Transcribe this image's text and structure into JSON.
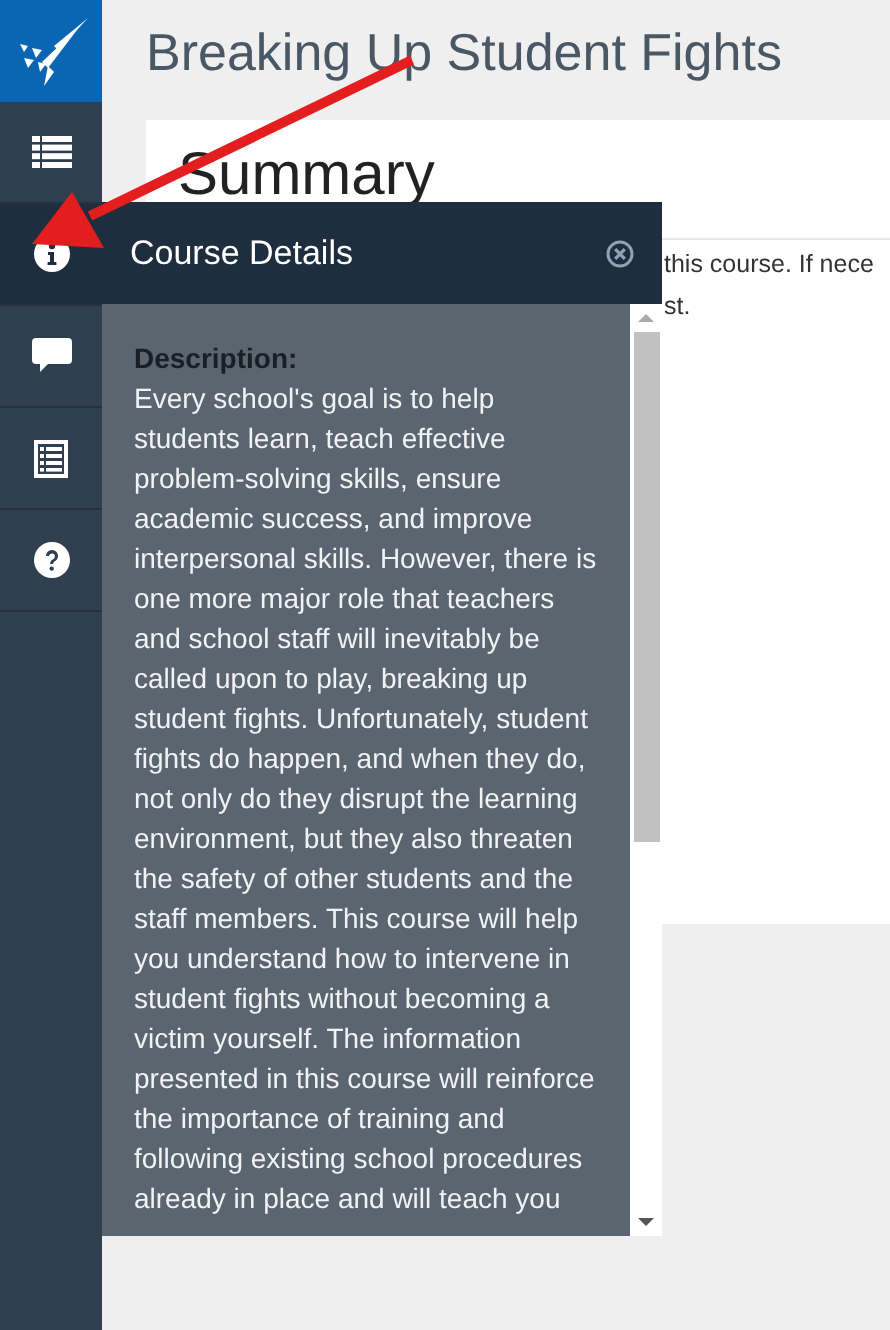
{
  "page_title": "Breaking Up Student Fights",
  "sidebar": {
    "items": [
      {
        "kind": "list",
        "selected": false
      },
      {
        "kind": "info",
        "selected": true
      },
      {
        "kind": "chat",
        "selected": false
      },
      {
        "kind": "table",
        "selected": false
      },
      {
        "kind": "help",
        "selected": false
      }
    ]
  },
  "card": {
    "heading": "Summary",
    "lines": [
      "this course. If nece",
      "st."
    ]
  },
  "panel": {
    "title": "Course Details",
    "description_label": "Description:",
    "description": "Every school's goal is to help students learn, teach effective problem-solving skills, ensure academic success, and improve interpersonal skills. However, there is one more major role that teachers and school staff will inevitably be called upon to play, breaking up student fights. Unfortunately, student fights do happen, and when they do, not only do they disrupt the learning environment, but they also threaten the safety of other students and the staff members. This course will help you understand how to intervene in student fights without becoming a victim yourself. The information presented in this course will reinforce the importance of training and following existing school procedures already in place and will teach you"
  }
}
